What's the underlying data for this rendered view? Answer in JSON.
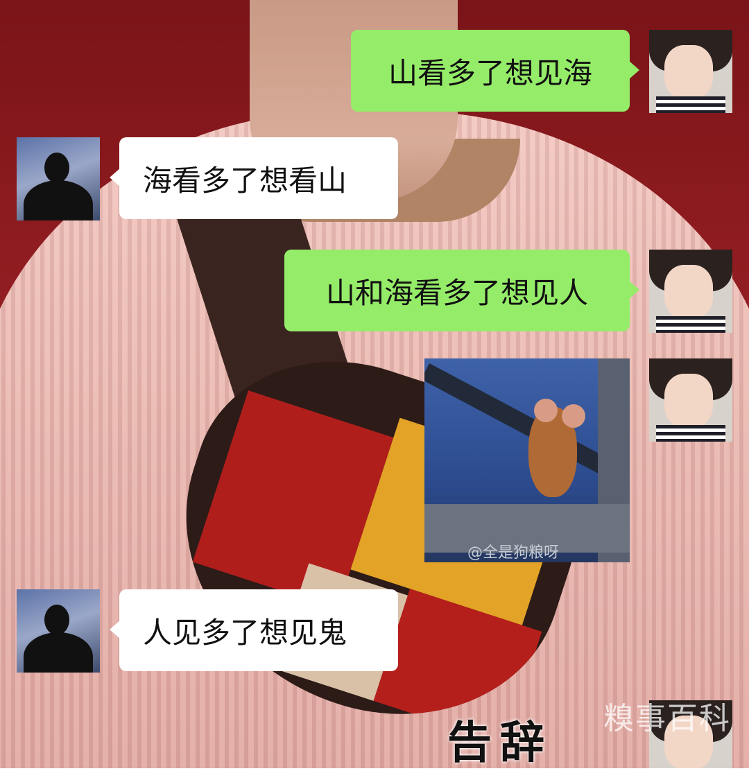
{
  "messages": [
    {
      "sender": "self",
      "text": "山看多了想见海"
    },
    {
      "sender": "other",
      "text": "海看多了想看山"
    },
    {
      "sender": "self",
      "text": "山和海看多了想见人"
    },
    {
      "sender": "self",
      "sticker_watermark": "@全是狗粮呀"
    },
    {
      "sender": "other",
      "text": "人见多了想见鬼"
    }
  ],
  "caption": "告辞",
  "brand_watermark": "糗事百科",
  "colors": {
    "outgoing_bubble": "#95ec69",
    "incoming_bubble": "#ffffff"
  },
  "icons": {
    "self_avatar": "girl-avatar-icon",
    "other_avatar": "silhouette-avatar-icon"
  }
}
